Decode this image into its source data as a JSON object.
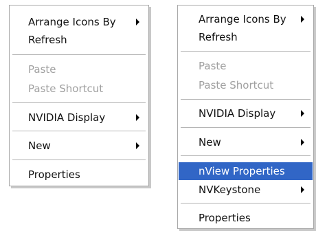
{
  "menu_left": {
    "arrange_icons_by": "Arrange Icons By",
    "refresh": "Refresh",
    "paste": "Paste",
    "paste_shortcut": "Paste Shortcut",
    "nvidia_display": "NVIDIA Display",
    "new": "New",
    "properties": "Properties"
  },
  "menu_right": {
    "arrange_icons_by": "Arrange Icons By",
    "refresh": "Refresh",
    "paste": "Paste",
    "paste_shortcut": "Paste Shortcut",
    "nvidia_display": "NVIDIA Display",
    "new": "New",
    "nview_properties": "nView Properties",
    "nvkeystone": "NVKeystone",
    "properties": "Properties"
  },
  "colors": {
    "highlight": "#3166c6",
    "disabled_text": "#a0a0a0"
  }
}
